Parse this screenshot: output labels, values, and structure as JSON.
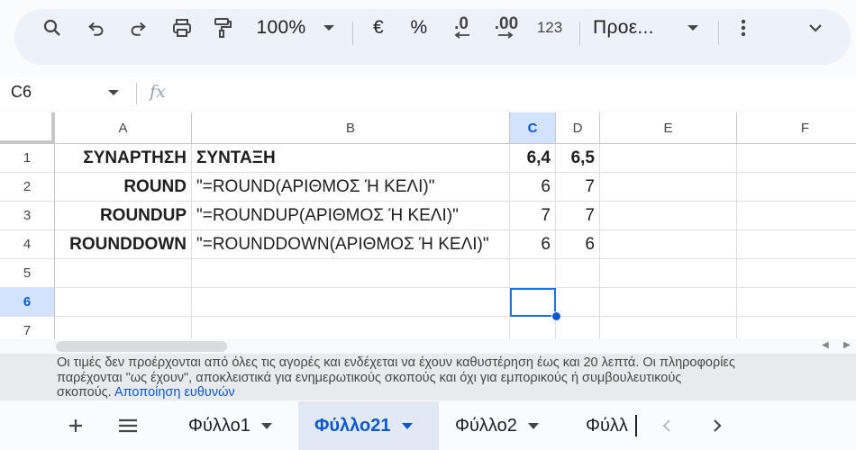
{
  "toolbar": {
    "zoom": "100%",
    "currency": "€",
    "percent": "%",
    "decrease_decimals": ".0",
    "increase_decimals": ".00",
    "number_format": "123",
    "font_style": "Προε...",
    "icons": [
      "search-icon",
      "undo-icon",
      "redo-icon",
      "print-icon",
      "paint-format-icon",
      "chevron-down-icon",
      "more-vert-icon",
      "collapse-chevron-icon"
    ]
  },
  "formula_bar": {
    "name_box": "C6",
    "fx_label": "fx",
    "formula": ""
  },
  "columns": [
    "A",
    "B",
    "C",
    "D",
    "E",
    "F"
  ],
  "selected_column": "C",
  "rows": [
    "1",
    "2",
    "3",
    "4",
    "5",
    "6",
    "7"
  ],
  "selected_row": "6",
  "cells": {
    "A1": "ΣΥΝΑΡΤΗΣΗ",
    "B1": "ΣΥΝΤΑΞΗ",
    "C1": "6,4",
    "D1": "6,5",
    "A2": "ROUND",
    "B2": "\"=ROUND(ΑΡΙΘΜΟΣ Ή ΚΕΛΙ)\"",
    "C2": "6",
    "D2": "7",
    "A3": "ROUNDUP",
    "B3": "\"=ROUNDUP(ΑΡΙΘΜΟΣ Ή ΚΕΛΙ)\"",
    "C3": "7",
    "D3": "7",
    "A4": "ROUNDDOWN",
    "B4": "\"=ROUNDDOWN(ΑΡΙΘΜΟΣ Ή ΚΕΛΙ)\"",
    "C4": "6",
    "D4": "6"
  },
  "disclaimer": {
    "line1": "Οι τιμές δεν προέρχονται από όλες τις αγορές και ενδέχεται να έχουν καθυστέρηση έως και 20 λεπτά. Οι πληροφορίες",
    "line2": "παρέχονται \"ως έχουν\", αποκλειστικά για ενημερωτικούς σκοπούς και όχι για εμπορικούς ή συμβουλευτικούς",
    "line3": "σκοπούς.",
    "link": "Αποποίηση ευθυνών"
  },
  "sheets": [
    {
      "name": "Φύλλο1",
      "active": false
    },
    {
      "name": "Φύλλο21",
      "active": true
    },
    {
      "name": "Φύλλο2",
      "active": false
    },
    {
      "name": "Φύλλ",
      "active": false
    }
  ],
  "colors": {
    "accent": "#0b57d0",
    "selection_header": "#d3e3fd",
    "toolbar_bg": "#edf2fa"
  }
}
